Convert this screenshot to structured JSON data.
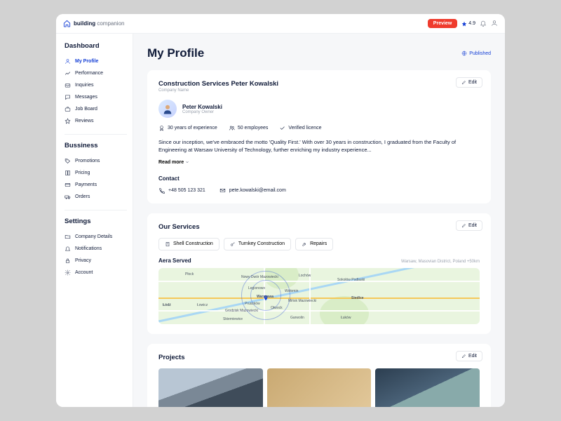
{
  "brand": {
    "name": "building",
    "suffix": "companion"
  },
  "topbar": {
    "preview": "Preview",
    "rating": "4.9"
  },
  "nav": {
    "dashboard": {
      "label": "Dashboard",
      "items": [
        "My Profile",
        "Performance",
        "Inquiries",
        "Messages",
        "Job Board",
        "Reviews"
      ]
    },
    "business": {
      "label": "Bussiness",
      "items": [
        "Promotions",
        "Pricing",
        "Payments",
        "Orders"
      ]
    },
    "settings": {
      "label": "Settings",
      "items": [
        "Company Details",
        "Notifications",
        "Privacy",
        "Account"
      ]
    }
  },
  "page": {
    "title": "My Profile",
    "published": "Published",
    "edit": "Edit"
  },
  "company": {
    "name": "Construction Services Peter Kowalski",
    "name_sub": "Company Name",
    "owner": "Peter Kowalski",
    "owner_sub": "Company Owner",
    "experience": "30 years of experience",
    "employees": "50 employees",
    "licence": "Verified licence",
    "bio": "Since our inception, we've embraced the motto 'Quality First.' With over 30 years in construction, I graduated from the Faculty of Engineering at Warsaw University of Technology, further enriching my industry experience...",
    "readmore": "Read more",
    "contact_label": "Contact",
    "phone": "+48 505 123 321",
    "email": "pete.kowalski@email.com"
  },
  "services": {
    "title": "Our Services",
    "chips": [
      "Shell Construction",
      "Turnkey Construction",
      "Repairs"
    ],
    "area_label": "Aera Served",
    "area_desc": "Warsaw, Masovian District, Poland +50km",
    "map_cities": [
      "Płock",
      "Nowy Dwór Mazowiecki",
      "Lochów",
      "Sokołów Podlaski",
      "Legionowo",
      "Wołomin",
      "Warszawa",
      "Pruszków",
      "Mińsk Mazowiecki",
      "Siedlce",
      "Łódź",
      "Łowicz",
      "Grodzisk Mazowiecki",
      "Skierniewice",
      "Garwolin",
      "Łuków",
      "Otwock"
    ]
  },
  "projects": {
    "title": "Projects"
  }
}
